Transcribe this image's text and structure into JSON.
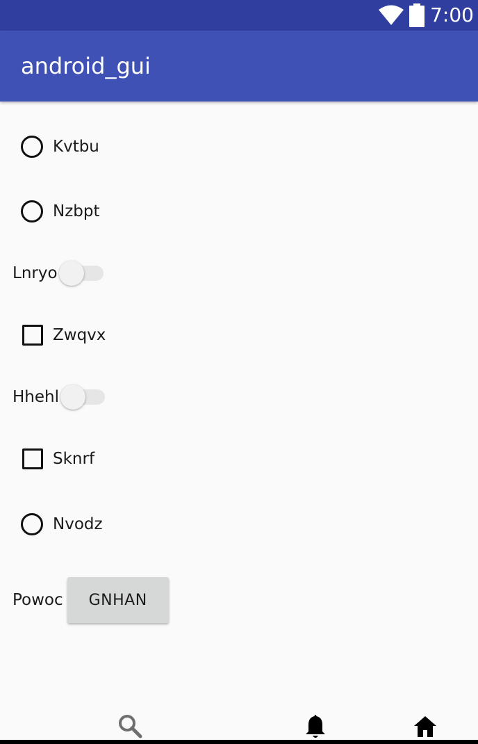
{
  "status_bar": {
    "time": "7:00",
    "icons": [
      "wifi-icon",
      "battery-icon"
    ]
  },
  "app_bar": {
    "title": "android_gui"
  },
  "controls": [
    {
      "type": "radio",
      "label": "Kvtbu",
      "checked": false
    },
    {
      "type": "radio",
      "label": "Nzbpt",
      "checked": false
    },
    {
      "type": "switch",
      "label": "Lnryo",
      "on": false
    },
    {
      "type": "checkbox",
      "label": "Zwqvx",
      "checked": false
    },
    {
      "type": "switch",
      "label": "Hhehl",
      "on": false
    },
    {
      "type": "checkbox",
      "label": "Sknrf",
      "checked": false
    },
    {
      "type": "radio",
      "label": "Nvodz",
      "checked": false
    }
  ],
  "button_row": {
    "label": "Powoc",
    "button_label": "GNHAN"
  },
  "bottom_nav": {
    "icons": [
      "search-icon",
      "bell-icon",
      "home-icon"
    ]
  },
  "colors": {
    "status_bar": "#303f9f",
    "app_bar": "#3f51b5",
    "background": "#fafafa",
    "button": "#d6d7d7"
  }
}
